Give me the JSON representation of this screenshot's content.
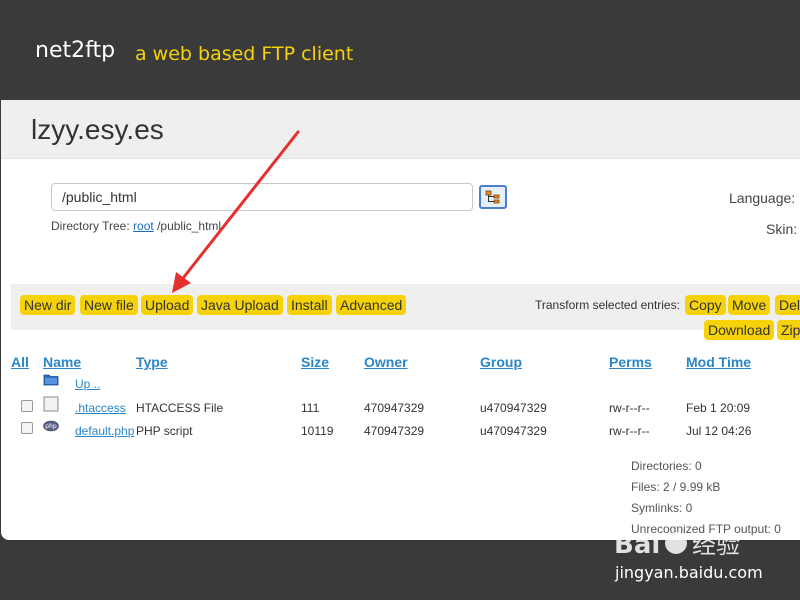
{
  "header": {
    "brand": "net2ftp",
    "tagline": "a web based FTP client"
  },
  "site": {
    "title": "lzyy.esy.es"
  },
  "directory": {
    "value": "/public_html",
    "tree_label": "Directory Tree:",
    "tree_root": "root",
    "tree_path": "/public_html"
  },
  "settings": {
    "language_label": "Language:",
    "skin_label": "Skin:"
  },
  "toolbar": {
    "new_dir": "New dir",
    "new_file": "New file",
    "upload": "Upload",
    "java_upload": "Java Upload",
    "install": "Install",
    "advanced": "Advanced",
    "transform_label": "Transform selected entries:",
    "copy": "Copy",
    "move": "Move",
    "delete_partial": "Del",
    "download": "Download",
    "zip_partial": "Zip"
  },
  "table": {
    "headers": {
      "all": "All",
      "name": "Name",
      "type": "Type",
      "size": "Size",
      "owner": "Owner",
      "group": "Group",
      "perms": "Perms",
      "mod_time": "Mod Time"
    },
    "up_label": "Up ..",
    "rows": [
      {
        "name": ".htaccess",
        "type": "HTACCESS File",
        "size": "111",
        "owner": "470947329",
        "group": "u470947329",
        "perms": "rw-r--r--",
        "mod_time": "Feb 1 20:09",
        "icon": "file-icon"
      },
      {
        "name": "default.php",
        "type": "PHP script",
        "size": "10119",
        "owner": "470947329",
        "group": "u470947329",
        "perms": "rw-r--r--",
        "mod_time": "Jul 12 04:26",
        "icon": "php-icon"
      }
    ]
  },
  "stats": {
    "directories": "Directories: 0",
    "files": "Files: 2 / 9.99 kB",
    "symlinks": "Symlinks: 0",
    "unrecognized": "Unrecognized FTP output: 0"
  },
  "watermark": {
    "text": "jingyan.baidu.com",
    "logo": "Baidu 经验"
  },
  "colors": {
    "accent": "#f5d20a",
    "link": "#2b86c8",
    "header_bg": "#3a3a3a",
    "annotation_arrow": "#e53030"
  }
}
